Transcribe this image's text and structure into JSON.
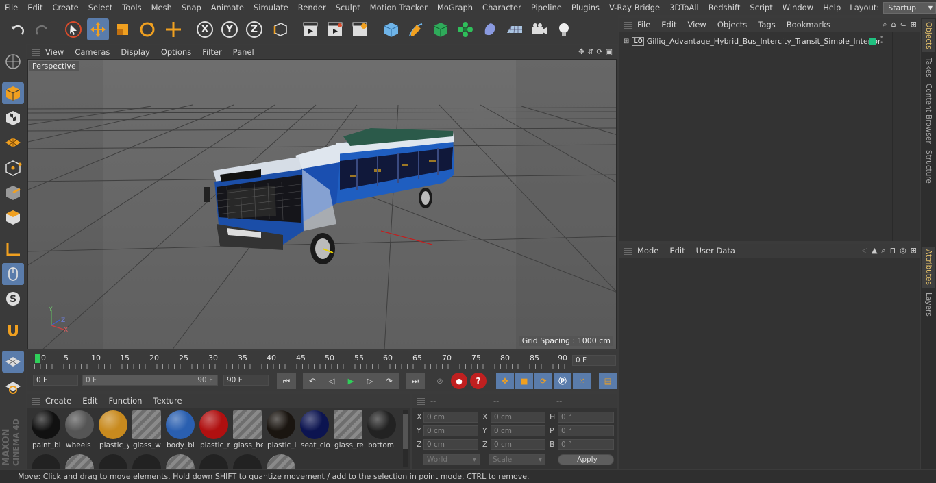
{
  "menubar": {
    "items": [
      "File",
      "Edit",
      "Create",
      "Select",
      "Tools",
      "Mesh",
      "Snap",
      "Animate",
      "Simulate",
      "Render",
      "Sculpt",
      "Motion Tracker",
      "MoGraph",
      "Character",
      "Pipeline",
      "Plugins",
      "V-Ray Bridge",
      "3DToAll",
      "Redshift",
      "Script",
      "Window",
      "Help"
    ],
    "layout_label": "Layout:",
    "layout_value": "Startup"
  },
  "toolbar": {
    "axis_x": "X",
    "axis_y": "Y",
    "axis_z": "Z"
  },
  "viewport": {
    "menus": [
      "View",
      "Cameras",
      "Display",
      "Options",
      "Filter",
      "Panel"
    ],
    "label": "Perspective",
    "grid_spacing": "Grid Spacing : 1000 cm",
    "axis_x": "X",
    "axis_y": "Y",
    "axis_z": "Z"
  },
  "timeline": {
    "ticks": [
      "0",
      "5",
      "10",
      "15",
      "20",
      "25",
      "30",
      "35",
      "40",
      "45",
      "50",
      "55",
      "60",
      "65",
      "70",
      "75",
      "80",
      "85",
      "90"
    ],
    "current_frame": "0 F"
  },
  "transport": {
    "start_field": "0 F",
    "range_start": "0 F",
    "range_end": "90 F",
    "end_field": "90 F"
  },
  "materials": {
    "menus": [
      "Create",
      "Edit",
      "Function",
      "Texture"
    ],
    "items": [
      {
        "name": "paint_bl",
        "color": "#111111"
      },
      {
        "name": "wheels",
        "color": "#555555"
      },
      {
        "name": "plastic_y",
        "color": "#c88a1e"
      },
      {
        "name": "glass_w",
        "color": "striped"
      },
      {
        "name": "body_bl",
        "color": "#2a5fb0"
      },
      {
        "name": "plastic_r",
        "color": "#b01010"
      },
      {
        "name": "glass_he",
        "color": "striped"
      },
      {
        "name": "plastic_l",
        "color": "#1a1510"
      },
      {
        "name": "seat_clo",
        "color": "#0c1450"
      },
      {
        "name": "glass_re",
        "color": "striped"
      },
      {
        "name": "bottom",
        "color": "#222222"
      }
    ]
  },
  "coords": {
    "headers": [
      "--",
      "--",
      "--"
    ],
    "rows": [
      {
        "l1": "X",
        "v1": "0 cm",
        "l2": "X",
        "v2": "0 cm",
        "l3": "H",
        "v3": "0 °"
      },
      {
        "l1": "Y",
        "v1": "0 cm",
        "l2": "Y",
        "v2": "0 cm",
        "l3": "P",
        "v3": "0 °"
      },
      {
        "l1": "Z",
        "v1": "0 cm",
        "l2": "Z",
        "v2": "0 cm",
        "l3": "B",
        "v3": "0 °"
      }
    ],
    "space": "World",
    "mode": "Scale",
    "apply": "Apply"
  },
  "objects": {
    "menus": [
      "File",
      "Edit",
      "View",
      "Objects",
      "Tags",
      "Bookmarks"
    ],
    "item_name": "Gillig_Advantage_Hybrid_Bus_Intercity_Transit_Simple_Interior",
    "layer_color": "#20c080"
  },
  "attributes": {
    "menus": [
      "Mode",
      "Edit",
      "User Data"
    ]
  },
  "sidetabs": [
    "Objects",
    "Takes",
    "Content Browser",
    "Structure",
    "Attributes",
    "Layers"
  ],
  "status": "Move: Click and drag to move elements. Hold down SHIFT to quantize movement / add to the selection in point mode, CTRL to remove.",
  "brand": {
    "line1": "MAXON",
    "line2": "CINEMA 4D"
  }
}
